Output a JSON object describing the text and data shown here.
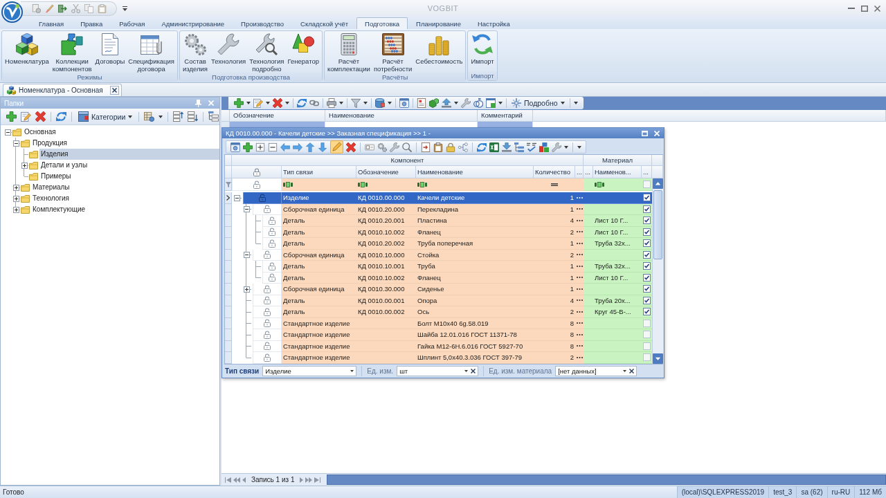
{
  "window": {
    "title": "VOGBIT"
  },
  "ribbon": {
    "tabs": [
      {
        "label": "Главная",
        "selected": false
      },
      {
        "label": "Правка",
        "selected": false
      },
      {
        "label": "Рабочая",
        "selected": false
      },
      {
        "label": "Администрирование",
        "selected": false
      },
      {
        "label": "Производство",
        "selected": false
      },
      {
        "label": "Складской учёт",
        "selected": false
      },
      {
        "label": "Подготовка",
        "selected": true
      },
      {
        "label": "Планирование",
        "selected": false
      },
      {
        "label": "Настройка",
        "selected": false
      }
    ],
    "groups": [
      {
        "label": "Режимы",
        "buttons": [
          "Номенклатура",
          "Коллекции компонентов",
          "Договоры",
          "Спецификация договора"
        ]
      },
      {
        "label": "Подготовка производства",
        "buttons": [
          "Состав изделия",
          "Технология",
          "Технология подробно",
          "Генератор"
        ]
      },
      {
        "label": "Расчёты",
        "buttons": [
          "Расчёт комплектации",
          "Расчёт потребности",
          "Себестоимость"
        ]
      },
      {
        "label": "Импорт",
        "buttons": [
          "Импорт"
        ]
      }
    ]
  },
  "documents": [
    {
      "label": "Номенклатура - Основная",
      "selected": true
    }
  ],
  "folders_panel": {
    "title": "Папки",
    "categories_button": "Категории",
    "tree": [
      {
        "label": "Основная",
        "expanded": true,
        "selected": false,
        "children": [
          {
            "label": "Продукция",
            "expanded": true,
            "selected": false,
            "children": [
              {
                "label": "Изделия",
                "selected": true
              },
              {
                "label": "Детали и узлы",
                "expanded": false,
                "selected": false
              },
              {
                "label": "Примеры",
                "selected": false
              }
            ]
          },
          {
            "label": "Материалы",
            "expanded": false,
            "selected": false
          },
          {
            "label": "Технология",
            "expanded": false,
            "selected": false
          },
          {
            "label": "Комплектующие",
            "expanded": false,
            "selected": false
          }
        ]
      }
    ]
  },
  "main_toolbar": {
    "details_button": "Подробно"
  },
  "main_grid": {
    "columns": [
      "Обозначение",
      "Наименование",
      "Комментарий"
    ]
  },
  "spec_window": {
    "title": "КД 0010.00.000 - Качели детские >> Заказная спецификация >> 1 -",
    "bands": [
      "Компонент",
      "Материал"
    ],
    "columns": [
      "Тип связи",
      "Обозначение",
      "Наименование",
      "Количество",
      "...",
      "...",
      "Наименов...",
      "..."
    ],
    "filter_row": {
      "checked": false
    },
    "rows": [
      {
        "type": "Изделие",
        "designation": "КД 0010.00.000",
        "name": "Качели детские",
        "quantity": "1",
        "checked": true,
        "selected": true,
        "expanded": true,
        "children": [
          {
            "type": "Сборочная единица",
            "designation": "КД 0010.20.000",
            "name": "Перекладина",
            "quantity": "1",
            "checked": true,
            "selected": false,
            "expanded": true,
            "children": [
              {
                "type": "Деталь",
                "designation": "КД 0010.20.001",
                "name": "Пластина",
                "quantity": "4",
                "material": "Лист 10 Г...",
                "checked": true,
                "selected": false
              },
              {
                "type": "Деталь",
                "designation": "КД 0010.10.002",
                "name": "Фланец",
                "quantity": "2",
                "material": "Лист 10 Г...",
                "checked": true,
                "selected": false
              },
              {
                "type": "Деталь",
                "designation": "КД 0010.20.002",
                "name": "Труба поперечная",
                "quantity": "1",
                "material": "Труба 32х...",
                "checked": true,
                "selected": false
              }
            ]
          },
          {
            "type": "Сборочная единица",
            "designation": "КД 0010.10.000",
            "name": "Стойка",
            "quantity": "2",
            "checked": true,
            "selected": false,
            "expanded": true,
            "children": [
              {
                "type": "Деталь",
                "designation": "КД 0010.10.001",
                "name": "Труба",
                "quantity": "1",
                "material": "Труба 32х...",
                "checked": true,
                "selected": false
              },
              {
                "type": "Деталь",
                "designation": "КД 0010.10.002",
                "name": "Фланец",
                "quantity": "1",
                "material": "Лист 10 Г...",
                "checked": true,
                "selected": false
              }
            ]
          },
          {
            "type": "Сборочная единица",
            "designation": "КД 0010.30.000",
            "name": "Сиденье",
            "quantity": "1",
            "checked": true,
            "selected": false,
            "expanded": false
          },
          {
            "type": "Деталь",
            "designation": "КД 0010.00.001",
            "name": "Опора",
            "quantity": "4",
            "material": "Труба 20х...",
            "checked": true,
            "selected": false
          },
          {
            "type": "Деталь",
            "designation": "КД 0010.00.002",
            "name": "Ось",
            "quantity": "2",
            "material": "Круг 45-В-...",
            "checked": true,
            "selected": false
          },
          {
            "type": "Стандартное изделие",
            "name": "Болт М10х40 6g.58.019",
            "quantity": "8",
            "checked": false,
            "selected": false
          },
          {
            "type": "Стандартное изделие",
            "name": "Шайба 12.01.016 ГОСТ 11371-78",
            "quantity": "8",
            "checked": false,
            "selected": false
          },
          {
            "type": "Стандартное изделие",
            "name": "Гайка М12-6Н.6.016 ГОСТ 5927-70",
            "quantity": "8",
            "checked": false,
            "selected": false
          },
          {
            "type": "Стандартное изделие",
            "name": "Шплинт 5,0х40.3.036 ГОСТ 397-79",
            "quantity": "2",
            "checked": false,
            "selected": false
          }
        ]
      }
    ],
    "editor": {
      "link_type_label": "Тип связи",
      "link_type": "Изделие",
      "unit_label": "Ед. изм.",
      "unit": "шт",
      "material_unit_label": "Ед. изм. материала",
      "material_unit": "[нет данных]"
    }
  },
  "navigator": {
    "text": "Запись 1 из 1"
  },
  "status_bar": {
    "text": "Готово",
    "segments": [
      "(local)\\SQLEXPRESS2019",
      "test_3",
      "sa (62)",
      "ru-RU",
      "112 Мб"
    ]
  }
}
